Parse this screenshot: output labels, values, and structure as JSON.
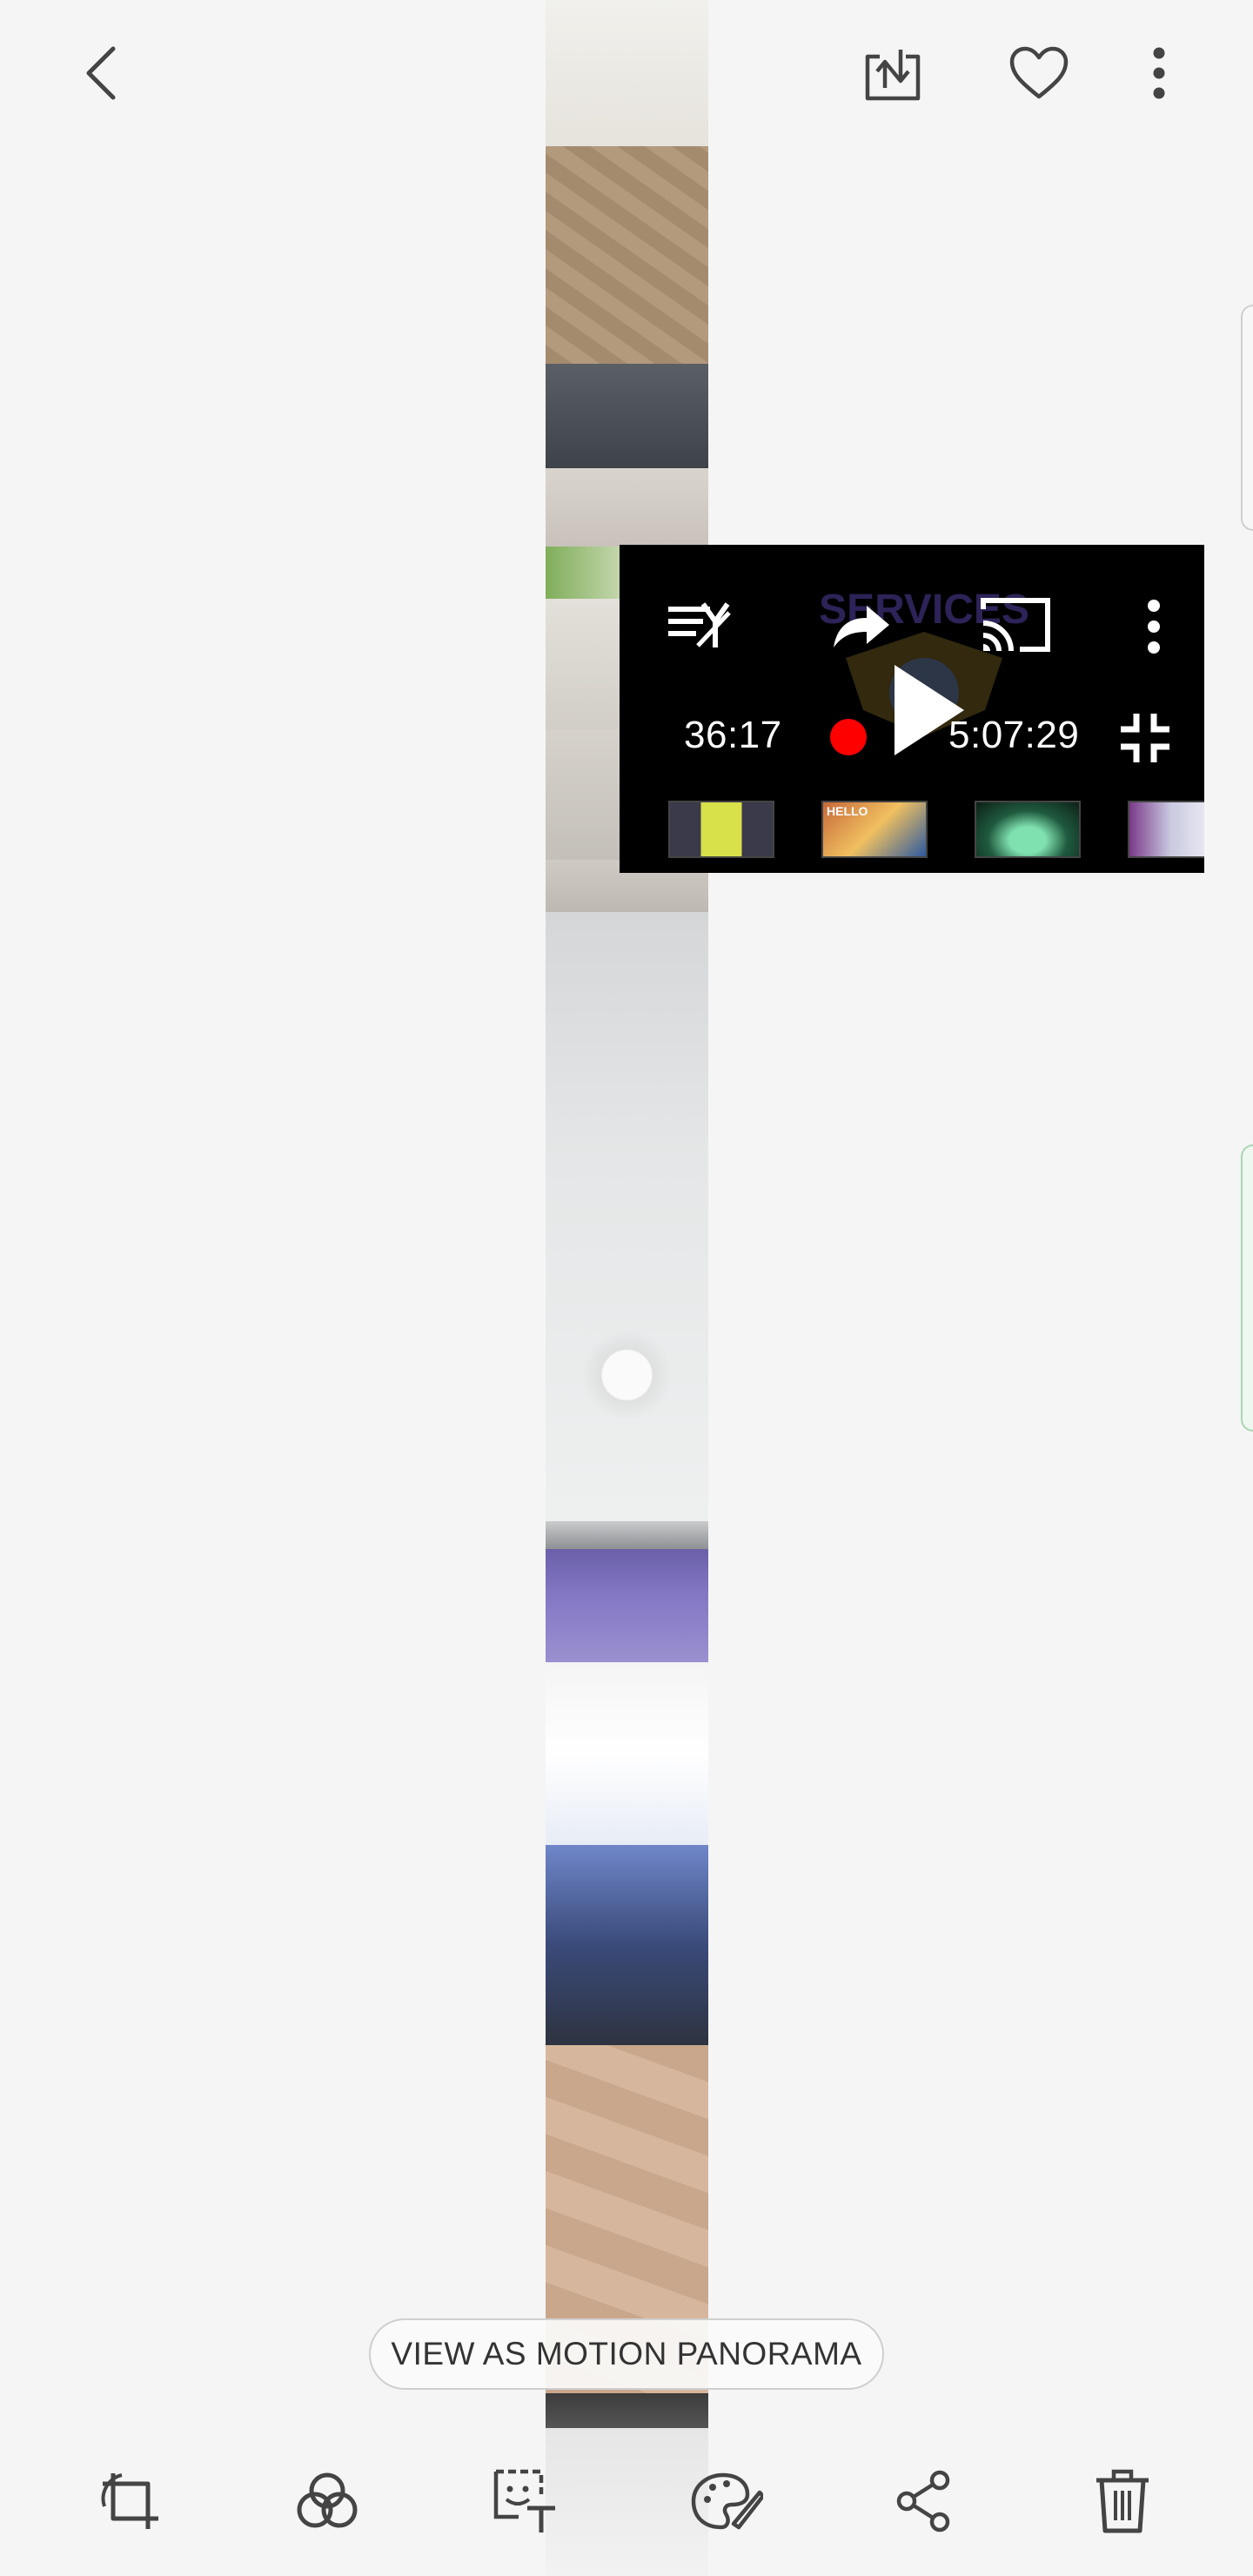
{
  "top_bar": {
    "back_icon": "back-arrow-icon",
    "save_icon": "download-to-device-icon",
    "favorite_icon": "heart-outline-icon",
    "more_icon": "more-vertical-icon"
  },
  "video_player": {
    "poster_text": "SERVICES",
    "elapsed_time": "36:17",
    "total_time": "5:07:29",
    "controls": {
      "quality_icon": "quality-settings-icon",
      "share_icon": "share-arrow-icon",
      "cast_icon": "cast-icon",
      "more_icon": "more-vertical-icon",
      "play_icon": "play-icon",
      "live_indicator_icon": "record-dot-icon",
      "exit_fullscreen_icon": "exit-fullscreen-icon"
    },
    "thumbnails": [
      {
        "caption": ""
      },
      {
        "caption": "HELLO"
      },
      {
        "caption": ""
      },
      {
        "caption": ""
      }
    ]
  },
  "motion_panorama_button": {
    "label": "VIEW AS MOTION PANORAMA"
  },
  "bottom_bar": {
    "items": [
      {
        "icon": "crop-rotate-icon"
      },
      {
        "icon": "filters-icon"
      },
      {
        "icon": "sticker-text-icon"
      },
      {
        "icon": "palette-brush-icon"
      },
      {
        "icon": "share-icon"
      },
      {
        "icon": "trash-icon"
      }
    ]
  },
  "colors": {
    "background": "#f5f5f5",
    "icon": "#444444",
    "player_bg": "#000000",
    "live_dot": "#ff0000"
  }
}
